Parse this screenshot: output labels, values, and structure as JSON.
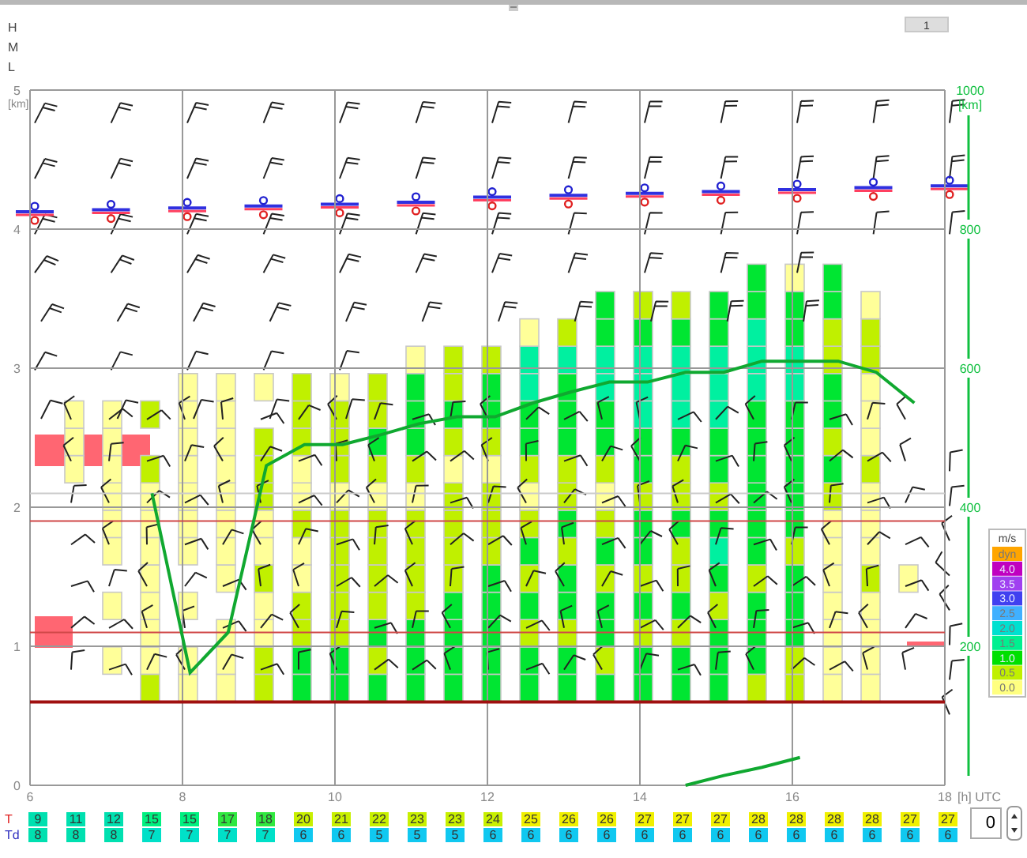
{
  "header": {
    "levels": [
      "H",
      "M",
      "L"
    ],
    "page_button": "1"
  },
  "chart": {
    "right_axis": {
      "labels": [
        "1000",
        "800",
        "600",
        "400",
        "200"
      ],
      "unit": "[km]"
    },
    "columns": [
      {
        "cells": [
          null,
          null,
          null,
          null,
          null,
          null,
          null,
          null,
          {
            "color": "#ffff99"
          },
          {
            "color": "#ffff99"
          },
          {
            "color": "#ffff99"
          }
        ]
      },
      {
        "cells": [
          null,
          {
            "color": "#ffff99"
          },
          null,
          {
            "color": "#ffff99"
          },
          null,
          {
            "color": "#ffff99"
          },
          {
            "color": "#ffff99"
          },
          {
            "color": "#ffff99"
          },
          {
            "color": "#ffff99"
          },
          {
            "color": "#ffff99"
          },
          {
            "color": "#ffff99"
          }
        ]
      },
      {
        "cells": [
          {
            "color": "#c0f000"
          },
          {
            "color": "#ffff99"
          },
          {
            "color": "#ffff99"
          },
          {
            "color": "#ffff99"
          },
          {
            "color": "#ffff99"
          },
          {
            "color": "#ffff99"
          },
          {
            "color": "#ffff99"
          },
          {
            "color": "#ffff99"
          },
          {
            "color": "#c0f000"
          },
          null,
          {
            "color": "#c0f000"
          }
        ]
      },
      {
        "cells": [
          {
            "color": "#ffff99"
          },
          {
            "color": "#ffff99"
          },
          null,
          {
            "color": "#ffff99"
          },
          null,
          {
            "color": "#ffff99"
          },
          {
            "color": "#ffff99"
          },
          {
            "color": "#ffff99"
          },
          {
            "color": "#ffff99"
          },
          {
            "color": "#ffff99"
          },
          {
            "color": "#ffff99"
          },
          {
            "color": "#ffff99"
          }
        ]
      },
      {
        "cells": [
          {
            "color": "#ffff99"
          },
          {
            "color": "#ffff99"
          },
          {
            "color": "#ffff99"
          },
          null,
          {
            "color": "#ffff99"
          },
          {
            "color": "#ffff99"
          },
          {
            "color": "#ffff99"
          },
          {
            "color": "#ffff99"
          },
          {
            "color": "#ffff99"
          },
          {
            "color": "#ffff99"
          },
          {
            "color": "#ffff99"
          },
          {
            "color": "#ffff99"
          }
        ]
      },
      {
        "cells": [
          {
            "color": "#c0f000"
          },
          {
            "color": "#c0f000"
          },
          {
            "color": "#ffff99"
          },
          {
            "color": "#ffff99"
          },
          {
            "color": "#c0f000"
          },
          {
            "color": "#ffff99"
          },
          {
            "color": "#ffff99"
          },
          {
            "color": "#c0f000"
          },
          {
            "color": "#c0f000"
          },
          {
            "color": "#c0f000"
          },
          null,
          {
            "color": "#ffff99"
          }
        ]
      },
      {
        "cells": [
          {
            "color": "#00e632"
          },
          {
            "color": "#00e632"
          },
          {
            "color": "#c0f000"
          },
          {
            "color": "#c0f000"
          },
          {
            "color": "#ffff99"
          },
          {
            "color": "#ffff99"
          },
          {
            "color": "#c0f000"
          },
          {
            "color": "#ffff99"
          },
          {
            "color": "#ffff99"
          },
          {
            "color": "#c0f000"
          },
          {
            "color": "#c0f000"
          },
          {
            "color": "#c0f000"
          }
        ]
      },
      {
        "cells": [
          {
            "color": "#00e632"
          },
          {
            "color": "#00e632"
          },
          {
            "color": "#c0f000"
          },
          {
            "color": "#c0f000"
          },
          {
            "color": "#c0f000"
          },
          {
            "color": "#c0f000"
          },
          {
            "color": "#c0f000"
          },
          {
            "color": "#ffff99"
          },
          {
            "color": "#c0f000"
          },
          {
            "color": "#c0f000"
          },
          {
            "color": "#c0f000"
          },
          {
            "color": "#ffff99"
          }
        ]
      },
      {
        "cells": [
          {
            "color": "#00e632"
          },
          {
            "color": "#c0f000"
          },
          {
            "color": "#00e632"
          },
          {
            "color": "#c0f000"
          },
          {
            "color": "#c0f000"
          },
          {
            "color": "#c0f000"
          },
          {
            "color": "#c0f000"
          },
          {
            "color": "#ffff99"
          },
          {
            "color": "#c0f000"
          },
          {
            "color": "#00e632"
          },
          {
            "color": "#c0f000"
          },
          {
            "color": "#c0f000"
          }
        ]
      },
      {
        "cells": [
          {
            "color": "#00e632"
          },
          {
            "color": "#00e632"
          },
          {
            "color": "#00e632"
          },
          {
            "color": "#c0f000"
          },
          {
            "color": "#c0f000"
          },
          {
            "color": "#c0f000"
          },
          {
            "color": "#c0f000"
          },
          {
            "color": "#ffff99"
          },
          {
            "color": "#c0f000"
          },
          {
            "color": "#00e632"
          },
          {
            "color": "#00e632"
          },
          {
            "color": "#00e632"
          },
          {
            "color": "#ffff99"
          }
        ]
      },
      {
        "cells": [
          {
            "color": "#00e632"
          },
          {
            "color": "#00e632"
          },
          {
            "color": "#00e632"
          },
          {
            "color": "#00e632"
          },
          {
            "color": "#c0f000"
          },
          {
            "color": "#c0f000"
          },
          {
            "color": "#c0f000"
          },
          {
            "color": "#c0f000"
          },
          {
            "color": "#ffff99"
          },
          {
            "color": "#c0f000"
          },
          {
            "color": "#00e632"
          },
          {
            "color": "#c0f000"
          },
          {
            "color": "#c0f000"
          }
        ]
      },
      {
        "cells": [
          {
            "color": "#00e632"
          },
          {
            "color": "#00e632"
          },
          {
            "color": "#00e632"
          },
          {
            "color": "#00e632"
          },
          {
            "color": "#00e632"
          },
          {
            "color": "#c0f000"
          },
          {
            "color": "#c0f000"
          },
          {
            "color": "#c0f000"
          },
          {
            "color": "#ffff99"
          },
          {
            "color": "#c0f000"
          },
          {
            "color": "#00e632"
          },
          {
            "color": "#00e632"
          },
          {
            "color": "#c0f000"
          }
        ]
      },
      {
        "cells": [
          {
            "color": "#00e632"
          },
          {
            "color": "#00e632"
          },
          {
            "color": "#c0f000"
          },
          {
            "color": "#00e632"
          },
          {
            "color": "#c0f000"
          },
          {
            "color": "#00e632"
          },
          {
            "color": "#c0f000"
          },
          {
            "color": "#ffff99"
          },
          {
            "color": "#c0f000"
          },
          {
            "color": "#00e632"
          },
          {
            "color": "#00e632"
          },
          {
            "color": "#00f0a0"
          },
          {
            "color": "#00f0a0"
          },
          {
            "color": "#ffff99"
          }
        ]
      },
      {
        "cells": [
          {
            "color": "#00e632"
          },
          {
            "color": "#00e632"
          },
          {
            "color": "#c0f000"
          },
          {
            "color": "#00e632"
          },
          {
            "color": "#00e632"
          },
          {
            "color": "#c0f000"
          },
          {
            "color": "#00e632"
          },
          {
            "color": "#c0f000"
          },
          {
            "color": "#c0f000"
          },
          {
            "color": "#00e632"
          },
          {
            "color": "#00e632"
          },
          {
            "color": "#00e632"
          },
          {
            "color": "#00f0a0"
          },
          {
            "color": "#c0f000"
          }
        ]
      },
      {
        "cells": [
          {
            "color": "#00e632"
          },
          {
            "color": "#c0f000"
          },
          {
            "color": "#00e632"
          },
          {
            "color": "#00e632"
          },
          {
            "color": "#c0f000"
          },
          {
            "color": "#00e632"
          },
          {
            "color": "#c0f000"
          },
          {
            "color": "#ffff99"
          },
          {
            "color": "#c0f000"
          },
          {
            "color": "#00e632"
          },
          {
            "color": "#00e632"
          },
          {
            "color": "#00f0a0"
          },
          {
            "color": "#00f0a0"
          },
          {
            "color": "#00e632"
          },
          {
            "color": "#00e632"
          }
        ]
      },
      {
        "cells": [
          {
            "color": "#00e632"
          },
          {
            "color": "#00e632"
          },
          {
            "color": "#c0f000"
          },
          {
            "color": "#00e632"
          },
          {
            "color": "#c0f000"
          },
          {
            "color": "#00e632"
          },
          {
            "color": "#00e632"
          },
          {
            "color": "#c0f000"
          },
          {
            "color": "#00e632"
          },
          {
            "color": "#00e632"
          },
          {
            "color": "#00f0a0"
          },
          {
            "color": "#00f0a0"
          },
          {
            "color": "#00f0a0"
          },
          {
            "color": "#00e632"
          },
          {
            "color": "#c0f000"
          }
        ]
      },
      {
        "cells": [
          {
            "color": "#00e632"
          },
          {
            "color": "#00e632"
          },
          {
            "color": "#c0f000"
          },
          {
            "color": "#00e632"
          },
          {
            "color": "#c0f000"
          },
          {
            "color": "#c0f000"
          },
          {
            "color": "#00e632"
          },
          {
            "color": "#c0f000"
          },
          {
            "color": "#c0f000"
          },
          {
            "color": "#00e632"
          },
          {
            "color": "#00f0a0"
          },
          {
            "color": "#00f0a0"
          },
          {
            "color": "#00f0a0"
          },
          {
            "color": "#00e632"
          },
          {
            "color": "#c0f000"
          }
        ]
      },
      {
        "cells": [
          {
            "color": "#00e632"
          },
          {
            "color": "#00e632"
          },
          {
            "color": "#00e632"
          },
          {
            "color": "#c0f000"
          },
          {
            "color": "#00e632"
          },
          {
            "color": "#00f0a0"
          },
          {
            "color": "#00e632"
          },
          {
            "color": "#c0f000"
          },
          {
            "color": "#00e632"
          },
          {
            "color": "#00e632"
          },
          {
            "color": "#00f0a0"
          },
          {
            "color": "#00f0a0"
          },
          {
            "color": "#00f0a0"
          },
          {
            "color": "#00e632"
          },
          {
            "color": "#00e632"
          }
        ]
      },
      {
        "cells": [
          {
            "color": "#c0f000"
          },
          {
            "color": "#00e632"
          },
          {
            "color": "#00e632"
          },
          {
            "color": "#00e632"
          },
          {
            "color": "#c0f000"
          },
          {
            "color": "#00e632"
          },
          {
            "color": "#00e632"
          },
          {
            "color": "#00e632"
          },
          {
            "color": "#00e632"
          },
          {
            "color": "#00e632"
          },
          {
            "color": "#00e632"
          },
          {
            "color": "#00f0a0"
          },
          {
            "color": "#00f0a0"
          },
          {
            "color": "#00f0a0"
          },
          {
            "color": "#00e632"
          },
          {
            "color": "#00e632"
          }
        ]
      },
      {
        "cells": [
          {
            "color": "#c0f000"
          },
          {
            "color": "#c0f000"
          },
          {
            "color": "#00e632"
          },
          {
            "color": "#00e632"
          },
          {
            "color": "#00e632"
          },
          {
            "color": "#c0f000"
          },
          {
            "color": "#00e632"
          },
          {
            "color": "#00e632"
          },
          {
            "color": "#00e632"
          },
          {
            "color": "#00e632"
          },
          {
            "color": "#00e632"
          },
          {
            "color": "#00f0a0"
          },
          {
            "color": "#00f0a0"
          },
          {
            "color": "#00e632"
          },
          {
            "color": "#00e632"
          },
          {
            "color": "#ffff99"
          }
        ]
      },
      {
        "cells": [
          {
            "color": "#ffff99"
          },
          {
            "color": "#ffff99"
          },
          {
            "color": "#ffff99"
          },
          {
            "color": "#ffff99"
          },
          {
            "color": "#ffff99"
          },
          {
            "color": "#ffff99"
          },
          {
            "color": "#ffff99"
          },
          {
            "color": "#c0f000"
          },
          {
            "color": "#00e632"
          },
          {
            "color": "#c0f000"
          },
          {
            "color": "#00e632"
          },
          {
            "color": "#00e632"
          },
          {
            "color": "#c0f000"
          },
          {
            "color": "#c0f000"
          },
          {
            "color": "#00e632"
          },
          {
            "color": "#00e632"
          }
        ]
      },
      {
        "cells": [
          {
            "color": "#ffff99"
          },
          {
            "color": "#ffff99"
          },
          {
            "color": "#ffff99"
          },
          {
            "color": "#ffff99"
          },
          {
            "color": "#c0f000"
          },
          {
            "color": "#ffff99"
          },
          {
            "color": "#ffff99"
          },
          {
            "color": "#ffff99"
          },
          {
            "color": "#c0f000"
          },
          {
            "color": "#ffff99"
          },
          {
            "color": "#ffff99"
          },
          {
            "color": "#ffff99"
          },
          {
            "color": "#c0f000"
          },
          {
            "color": "#c0f000"
          },
          {
            "color": "#ffff99"
          }
        ]
      },
      {
        "cells": [
          null,
          null,
          null,
          null,
          {
            "color": "#ffff99"
          }
        ]
      }
    ],
    "chart_data": {
      "type": "line",
      "xlabel": "[h] UTC",
      "ylabel": "[km]",
      "xlim": [
        6,
        18
      ],
      "ylim": [
        0,
        5
      ],
      "xticks": [
        {
          "value": 6,
          "label": "6"
        },
        {
          "value": 8,
          "label": "8"
        },
        {
          "value": 10,
          "label": "10"
        },
        {
          "value": 12,
          "label": "12"
        },
        {
          "value": 14,
          "label": "14"
        },
        {
          "value": 16,
          "label": "16"
        },
        {
          "value": 18,
          "label": "18"
        }
      ],
      "yticks": [
        {
          "value": 0,
          "label": "0"
        },
        {
          "value": 1,
          "label": "1"
        },
        {
          "value": 2,
          "label": "2"
        },
        {
          "value": 3,
          "label": "3"
        },
        {
          "value": 4,
          "label": "4"
        },
        {
          "value": 5,
          "label": "5"
        }
      ],
      "grid": true,
      "ref_lines": [
        {
          "axis": "y",
          "value": 2.1,
          "color": "#cccccc"
        },
        {
          "axis": "y",
          "value": 1.9,
          "color": "#d04848"
        },
        {
          "axis": "y",
          "value": 1.1,
          "color": "#d04848"
        },
        {
          "axis": "y",
          "value": 0.6,
          "color": "#a01010"
        }
      ],
      "x": [
        7.6,
        8.1,
        8.6,
        9.1,
        9.6,
        10.1,
        10.6,
        11.1,
        11.6,
        12.1,
        12.6,
        13.1,
        13.6,
        14.1,
        14.6,
        15.1,
        15.6,
        16.1,
        16.6,
        17.1,
        17.6
      ],
      "series": [
        {
          "color": "#10a830",
          "values": [
            2.1,
            0.81,
            1.1,
            2.3,
            2.45,
            2.45,
            2.52,
            2.6,
            2.65,
            2.65,
            2.75,
            2.83,
            2.9,
            2.9,
            2.97,
            2.97,
            3.05,
            3.05,
            3.05,
            2.97,
            2.75
          ]
        },
        {
          "color": "#10a830",
          "values": [
            null,
            null,
            null,
            null,
            null,
            null,
            null,
            null,
            null,
            null,
            null,
            null,
            null,
            null,
            0,
            0.07,
            0.13,
            0.2,
            null,
            null,
            null
          ]
        }
      ]
    }
  },
  "legend": {
    "title": "m/s",
    "items": [
      {
        "label": "dyn",
        "color": "#ffa500"
      },
      {
        "label": "4.0",
        "color": "#c000c0"
      },
      {
        "label": "3.5",
        "color": "#a040f0"
      },
      {
        "label": "3.0",
        "color": "#4040f0"
      },
      {
        "label": "2.5",
        "color": "#40b0ff"
      },
      {
        "label": "2.0",
        "color": "#00e0d0"
      },
      {
        "label": "1.5",
        "color": "#00f090"
      },
      {
        "label": "1.0",
        "color": "#00e000"
      },
      {
        "label": "0.5",
        "color": "#c0f000"
      },
      {
        "label": "0.0",
        "color": "#ffff80"
      }
    ]
  },
  "rows": [
    {
      "label": "T",
      "color": "#e02020",
      "values": [
        {
          "text": "9",
          "color": "#00e0b0"
        },
        {
          "text": "11",
          "color": "#00e0b0"
        },
        {
          "text": "12",
          "color": "#00e0b0"
        },
        {
          "text": "15",
          "color": "#00f080"
        },
        {
          "text": "15",
          "color": "#00f080"
        },
        {
          "text": "17",
          "color": "#30e840"
        },
        {
          "text": "18",
          "color": "#30e840"
        },
        {
          "text": "20",
          "color": "#c8f000"
        },
        {
          "text": "21",
          "color": "#c8f000"
        },
        {
          "text": "22",
          "color": "#c8f000"
        },
        {
          "text": "23",
          "color": "#c8f000"
        },
        {
          "text": "23",
          "color": "#c8f000"
        },
        {
          "text": "24",
          "color": "#c8f000"
        },
        {
          "text": "25",
          "color": "#f0f000"
        },
        {
          "text": "26",
          "color": "#f0f000"
        },
        {
          "text": "26",
          "color": "#f0f000"
        },
        {
          "text": "27",
          "color": "#f0f000"
        },
        {
          "text": "27",
          "color": "#f0f000"
        },
        {
          "text": "27",
          "color": "#f0f000"
        },
        {
          "text": "28",
          "color": "#f0f000"
        },
        {
          "text": "28",
          "color": "#f0f000"
        },
        {
          "text": "28",
          "color": "#f0f000"
        },
        {
          "text": "28",
          "color": "#f0f000"
        },
        {
          "text": "27",
          "color": "#f0f000"
        },
        {
          "text": "27",
          "color": "#f0f000"
        }
      ]
    },
    {
      "label": "Td",
      "color": "#3030c0",
      "values": [
        {
          "text": "8",
          "color": "#00e0b0"
        },
        {
          "text": "8",
          "color": "#00e0b0"
        },
        {
          "text": "8",
          "color": "#00e0b0"
        },
        {
          "text": "7",
          "color": "#00e0c8"
        },
        {
          "text": "7",
          "color": "#00e0c8"
        },
        {
          "text": "7",
          "color": "#00e0c8"
        },
        {
          "text": "7",
          "color": "#00e0c8"
        },
        {
          "text": "6",
          "color": "#10c8f0"
        },
        {
          "text": "6",
          "color": "#10c8f0"
        },
        {
          "text": "5",
          "color": "#10c8f0"
        },
        {
          "text": "5",
          "color": "#10c8f0"
        },
        {
          "text": "5",
          "color": "#10c8f0"
        },
        {
          "text": "6",
          "color": "#10c8f0"
        },
        {
          "text": "6",
          "color": "#10c8f0"
        },
        {
          "text": "6",
          "color": "#10c8f0"
        },
        {
          "text": "6",
          "color": "#10c8f0"
        },
        {
          "text": "6",
          "color": "#10c8f0"
        },
        {
          "text": "6",
          "color": "#10c8f0"
        },
        {
          "text": "6",
          "color": "#10c8f0"
        },
        {
          "text": "6",
          "color": "#10c8f0"
        },
        {
          "text": "6",
          "color": "#10c8f0"
        },
        {
          "text": "6",
          "color": "#10c8f0"
        },
        {
          "text": "6",
          "color": "#10c8f0"
        },
        {
          "text": "6",
          "color": "#10c8f0"
        },
        {
          "text": "6",
          "color": "#10c8f0"
        }
      ]
    }
  ],
  "spin_field": {
    "value": "0"
  }
}
